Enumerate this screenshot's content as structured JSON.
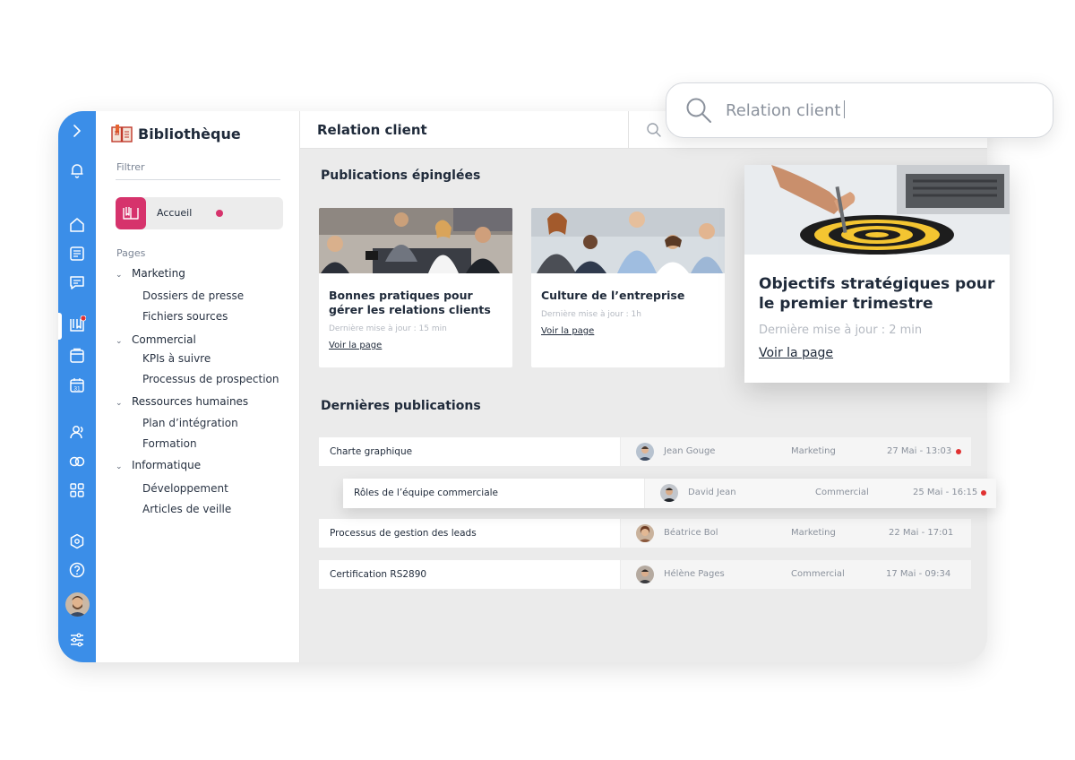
{
  "colors": {
    "rail": "#3b8ee8",
    "accent": "#d6336c",
    "alert": "#e03131"
  },
  "rail": {
    "icons": [
      "chevron-right-icon",
      "bell-icon",
      "home-icon",
      "news-icon",
      "chat-icon",
      "library-icon",
      "folder-icon",
      "calendar-icon",
      "users-icon",
      "toggle-icon",
      "apps-icon",
      "hexagon-icon",
      "help-icon",
      "settings-sliders-icon"
    ],
    "calendar_day": "31"
  },
  "library": {
    "title": "Bibliothèque",
    "filter_placeholder": "Filtrer",
    "home_label": "Accueil",
    "pages_label": "Pages",
    "groups": [
      {
        "label": "Marketing",
        "items": [
          "Dossiers de presse",
          "Fichiers sources"
        ]
      },
      {
        "label": "Commercial",
        "items": [
          "KPIs à suivre",
          "Processus de prospection"
        ]
      },
      {
        "label": "Ressources humaines",
        "items": [
          "Plan d’intégration",
          "Formation"
        ]
      },
      {
        "label": "Informatique",
        "items": [
          "Développement",
          "Articles de veille"
        ]
      }
    ]
  },
  "main": {
    "title": "Relation client",
    "pinned_title": "Publications épinglées",
    "latest_title": "Dernières publications",
    "pinned": [
      {
        "title": "Bonnes pratiques pour gérer les relations clients",
        "meta": "Dernière mise à jour : 15 min",
        "link": "Voir la page"
      },
      {
        "title": "Culture de l’entreprise",
        "meta": "Dernière mise à jour : 1h",
        "link": "Voir la page"
      },
      {
        "title": "Objectifs stratégiques pour le premier trimestre",
        "meta": "Dernière mise à jour : 2 min",
        "link": "Voir la page"
      }
    ],
    "latest": [
      {
        "title": "Charte graphique",
        "author": "Jean Gouge",
        "category": "Marketing",
        "date": "27 Mai - 13:03",
        "unread": true
      },
      {
        "title": "Rôles de l’équipe commerciale",
        "author": "David Jean",
        "category": "Commercial",
        "date": "25 Mai - 16:15",
        "unread": true
      },
      {
        "title": "Processus de gestion des leads",
        "author": "Béatrice Bol",
        "category": "Marketing",
        "date": "22 Mai - 17:01",
        "unread": false
      },
      {
        "title": "Certification RS2890",
        "author": "Hélène Pages",
        "category": "Commercial",
        "date": "17 Mai - 09:34",
        "unread": false
      }
    ]
  },
  "search": {
    "value": "Relation client"
  }
}
